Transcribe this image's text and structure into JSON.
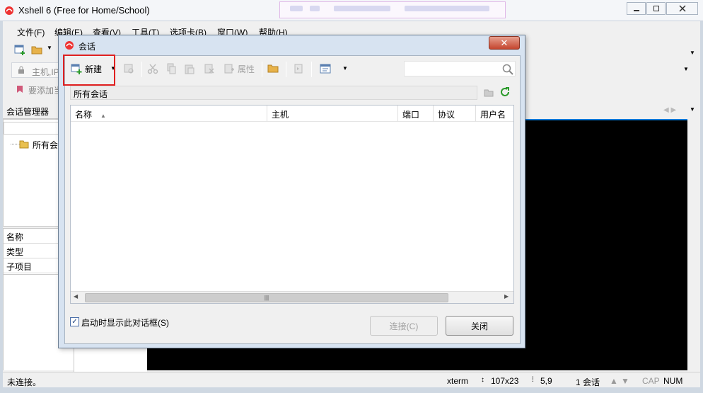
{
  "main": {
    "title": "Xshell 6 (Free for Home/School)",
    "menu": [
      "文件(F)",
      "编辑(E)",
      "查看(V)",
      "工具(T)",
      "选项卡(B)",
      "窗口(W)",
      "帮助(H)"
    ],
    "address_placeholder": "主机,IP",
    "addbar_text": "要添加当"
  },
  "session_manager": {
    "header": "会话管理器",
    "tree_root": "所有会话",
    "properties": [
      "名称",
      "类型",
      "子项目"
    ]
  },
  "dialog": {
    "title": "会话",
    "toolbar": {
      "new_label": "新建",
      "properties_label": "属性"
    },
    "path": "所有会话",
    "columns": [
      "名称",
      "主机",
      "端口",
      "协议",
      "用户名"
    ],
    "startup_checkbox_label": "启动时显示此对话框(S)",
    "startup_checked": true,
    "connect_label": "连接(C)",
    "close_label": "关闭"
  },
  "statusbar": {
    "connection": "未连接。",
    "term": "xterm",
    "size": "107x23",
    "cursor": "5,9",
    "sessions": "1 会话",
    "caps": "CAP",
    "num": "NUM"
  },
  "colors": {
    "highlight": "#e02020",
    "accent": "#0078d7",
    "terminal_bg": "#000000"
  }
}
